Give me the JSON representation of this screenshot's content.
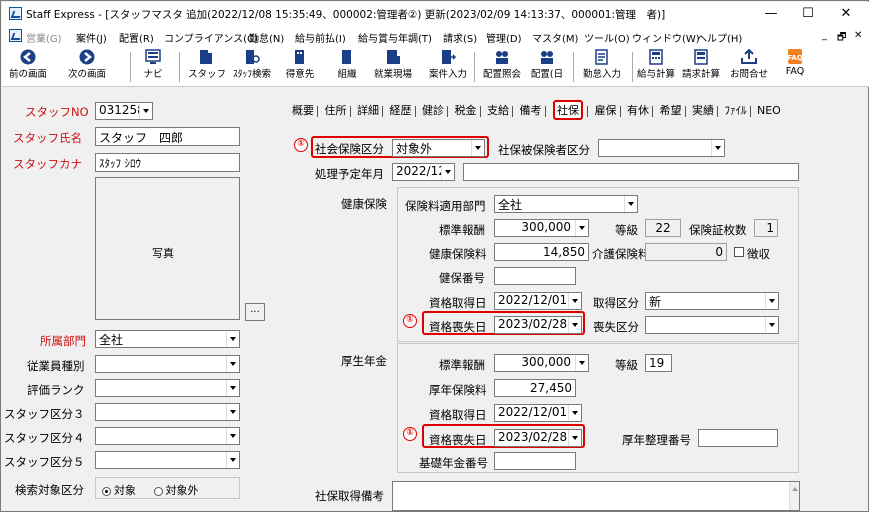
{
  "window": {
    "title": "Staff Express - [スタッフマスタ 追加(2022/12/08 15:35:49、000002:管理者②) 更新(2023/02/09 14:13:37、000001:管理　者)]",
    "minimize": "—",
    "maximize": "☐",
    "close": "✕"
  },
  "menu": {
    "items": [
      "営業(G)",
      "案件(J)",
      "配置(R)",
      "コンプライアンス(C)",
      "勤怠(N)",
      "給与前払(I)",
      "給与賞与年調(T)",
      "請求(S)",
      "管理(D)",
      "マスタ(M)",
      "ツール(O)",
      "ウィンドウ(W)",
      "ヘルプ(H)"
    ],
    "mdi_controls": [
      "_",
      "🗗",
      "✕"
    ]
  },
  "toolbar": {
    "prev": "前の画面",
    "next": "次の画面",
    "navi": "ナビ",
    "staff": "スタッフ",
    "staff_search": "ｽﾀｯﾌ検索",
    "client": "得意先",
    "org": "組織",
    "workplace": "就業現場",
    "case_entry": "案件入力",
    "placement_inquiry": "配置照会",
    "placement_day": "配置(日",
    "attendance_entry": "勤怠入力",
    "payroll_calc": "給与計算",
    "billing_calc": "請求計算",
    "inquiry": "お問合せ",
    "faq": "FAQ"
  },
  "left": {
    "staff_no_label": "スタッフNO",
    "staff_no": "031258",
    "staff_name_label": "スタッフ氏名",
    "staff_name": "スタッフ　四郎",
    "staff_kana_label": "スタッフカナ",
    "staff_kana": "ｽﾀｯﾌ ｼﾛｳ",
    "photo_label": "写真",
    "photo_btn": "...",
    "dept_label": "所属部門",
    "dept": "全社",
    "emp_type_label": "従業員種別",
    "eval_rank_label": "評価ランク",
    "staff_cat3_label": "スタッフ区分３",
    "staff_cat4_label": "スタッフ区分４",
    "staff_cat5_label": "スタッフ区分５",
    "search_target_label": "検索対象区分",
    "search_target_on": "対象",
    "search_target_off": "対象外"
  },
  "tabs": [
    "概要",
    "住所",
    "詳細",
    "経歴",
    "健診",
    "税金",
    "支給",
    "備考",
    "社保",
    "雇保",
    "有休",
    "希望",
    "実績",
    "ﾌｧｲﾙ",
    "NEO"
  ],
  "active_tab": "社保",
  "shaho": {
    "marker": "①",
    "social_ins_label": "社会保険区分",
    "social_ins": "対象外",
    "insured_cat_label": "社保被保険者区分",
    "insured_cat": "",
    "process_month_label": "処理予定年月",
    "process_month": "2022/12",
    "health": {
      "section": "健康保険",
      "dept_label": "保険料適用部門",
      "dept": "全社",
      "std_label": "標準報酬",
      "std": "300,000",
      "grade_label": "等級",
      "grade": "22",
      "cards_label": "保険証枚数",
      "cards": "1",
      "premium_label": "健康保険料",
      "premium": "14,850",
      "care_label": "介護保険料",
      "care": "0",
      "collect_label": "徴収",
      "number_label": "健保番号",
      "number": "",
      "acquired_label": "資格取得日",
      "acquired": "2022/12/01",
      "acq_type_label": "取得区分",
      "acq_type": "新",
      "lost_label": "資格喪失日",
      "lost": "2023/02/28",
      "lost_type_label": "喪失区分",
      "lost_type": ""
    },
    "pension": {
      "section": "厚生年金",
      "std_label": "標準報酬",
      "std": "300,000",
      "grade_label": "等級",
      "grade": "19",
      "premium_label": "厚年保険料",
      "premium": "27,450",
      "acquired_label": "資格取得日",
      "acquired": "2022/12/01",
      "lost_label": "資格喪失日",
      "lost": "2023/02/28",
      "ref_no_label": "厚年整理番号",
      "ref_no": "",
      "basic_no_label": "基礎年金番号",
      "basic_no": ""
    },
    "remarks_label": "社保取得備考",
    "remarks": ""
  },
  "colors": {
    "highlight": "#e00000",
    "required_label": "#d01010"
  }
}
